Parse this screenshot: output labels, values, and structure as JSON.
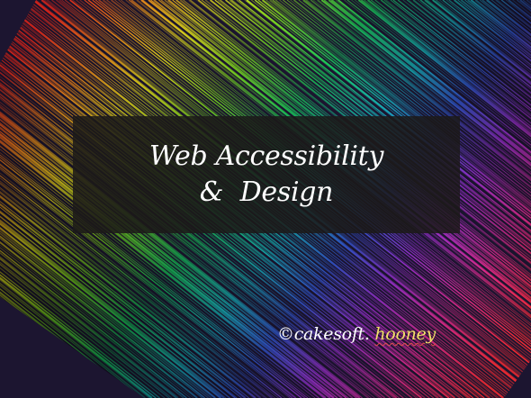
{
  "slide": {
    "title_line1": "Web Accessibility",
    "title_line2": "&  Design",
    "credit_prefix": "©cakesoft. ",
    "credit_name": "hooney"
  },
  "colors": {
    "background": "#1c1530",
    "title_box": "#1c1a18",
    "title_text": "#ffffff",
    "credit_name": "#f3e06a",
    "spellcheck_underline": "#e0524a"
  }
}
